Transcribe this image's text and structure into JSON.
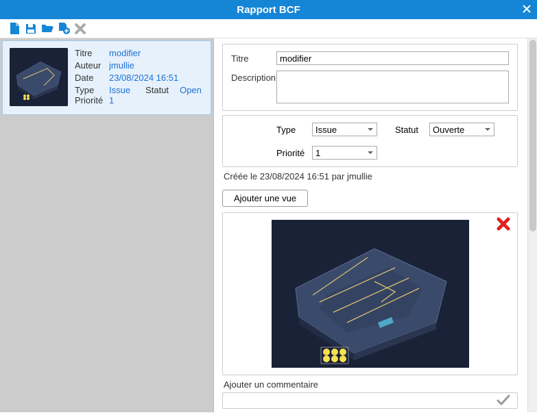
{
  "titlebar": {
    "title": "Rapport BCF"
  },
  "toolbar": {
    "new": "new",
    "save": "save",
    "open": "open",
    "save_as": "save-as",
    "delete": "delete"
  },
  "card": {
    "labels": {
      "title": "Titre",
      "author": "Auteur",
      "date": "Date",
      "type": "Type",
      "status": "Statut",
      "priority": "Priorité"
    },
    "title": "modifier",
    "author": "jmullie",
    "date": "23/08/2024 16:51",
    "type": "Issue",
    "status": "Open",
    "priority": "1"
  },
  "form": {
    "labels": {
      "title": "Titre",
      "description": "Description",
      "type": "Type",
      "status": "Statut",
      "priority": "Priorité"
    },
    "title_value": "modifier",
    "type_value": "Issue",
    "status_value": "Ouverte",
    "priority_value": "1"
  },
  "created": "Créée le 23/08/2024 16:51 par jmullie",
  "add_view_btn": "Ajouter une vue",
  "comment_label": "Ajouter un commentaire"
}
